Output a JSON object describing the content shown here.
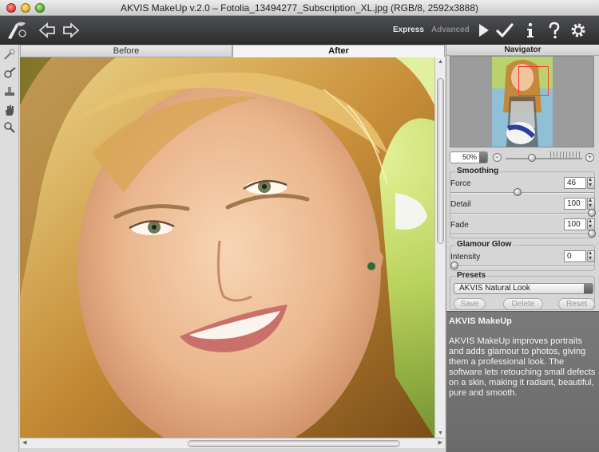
{
  "window": {
    "title": "AKVIS MakeUp v.2.0 – Fotolia_13494277_Subscription_XL.jpg (RGB/8, 2592x3888)"
  },
  "toolbar": {
    "mode_express": "Express",
    "mode_advanced": "Advanced",
    "icons": [
      "back-arrow-icon",
      "forward-arrow-icon",
      "run-icon",
      "apply-checkmark-icon",
      "info-icon",
      "help-icon",
      "settings-gear-icon"
    ]
  },
  "tabs": {
    "before": "Before",
    "after": "After",
    "active": "After"
  },
  "navigator": {
    "title": "Navigator",
    "zoom": "50%",
    "zoom_minus": "−",
    "zoom_plus": "+",
    "zoom_level": 0.34
  },
  "smoothing": {
    "title": "Smoothing",
    "force_label": "Force",
    "force_value": "46",
    "force_level": 0.46,
    "detail_label": "Detail",
    "detail_value": "100",
    "detail_level": 1.0,
    "fade_label": "Fade",
    "fade_value": "100",
    "fade_level": 1.0
  },
  "glamour": {
    "title": "Glamour Glow",
    "intensity_label": "Intensity",
    "intensity_value": "0",
    "intensity_level": 0
  },
  "presets": {
    "title": "Presets",
    "selected": "AKVIS Natural Look",
    "save": "Save",
    "delete": "Delete",
    "reset": "Reset"
  },
  "info": {
    "title": "AKVIS MakeUp",
    "text": "AKVIS MakeUp improves portraits and adds glamour to photos, giving them a professional look. The software lets retouching small defects on a skin, making it radiant, beautiful, pure and smooth."
  },
  "colors": {
    "toolbar_bg": "#3a3b3d",
    "panel_bg": "#d6d6d6",
    "info_bg": "#737373",
    "nav_rect": "#ff3b2f"
  }
}
